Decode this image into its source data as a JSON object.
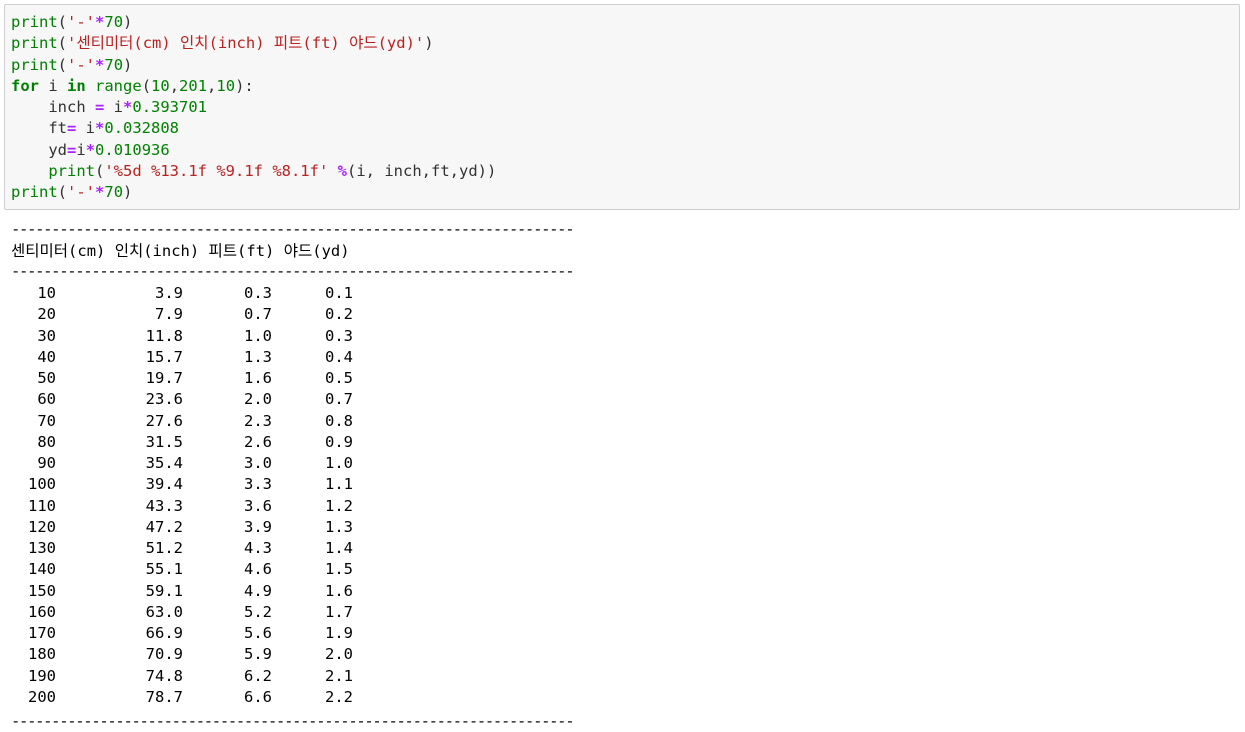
{
  "code": {
    "lines": [
      [
        {
          "t": "print",
          "c": "bi"
        },
        {
          "t": "(",
          "c": "plain"
        },
        {
          "t": "'-'",
          "c": "st"
        },
        {
          "t": "*",
          "c": "op"
        },
        {
          "t": "70",
          "c": "nm"
        },
        {
          "t": ")",
          "c": "plain"
        }
      ],
      [
        {
          "t": "print",
          "c": "bi"
        },
        {
          "t": "(",
          "c": "plain"
        },
        {
          "t": "'센티미터(cm) 인치(inch) 피트(ft) 야드(yd)'",
          "c": "st"
        },
        {
          "t": ")",
          "c": "plain"
        }
      ],
      [
        {
          "t": "print",
          "c": "bi"
        },
        {
          "t": "(",
          "c": "plain"
        },
        {
          "t": "'-'",
          "c": "st"
        },
        {
          "t": "*",
          "c": "op"
        },
        {
          "t": "70",
          "c": "nm"
        },
        {
          "t": ")",
          "c": "plain"
        }
      ],
      [
        {
          "t": "for",
          "c": "kw"
        },
        {
          "t": " i ",
          "c": "plain"
        },
        {
          "t": "in",
          "c": "kw"
        },
        {
          "t": " ",
          "c": "plain"
        },
        {
          "t": "range",
          "c": "bi"
        },
        {
          "t": "(",
          "c": "plain"
        },
        {
          "t": "10",
          "c": "nm"
        },
        {
          "t": ",",
          "c": "plain"
        },
        {
          "t": "201",
          "c": "nm"
        },
        {
          "t": ",",
          "c": "plain"
        },
        {
          "t": "10",
          "c": "nm"
        },
        {
          "t": "):",
          "c": "plain"
        }
      ],
      [
        {
          "t": "    inch ",
          "c": "plain"
        },
        {
          "t": "=",
          "c": "op"
        },
        {
          "t": " i",
          "c": "plain"
        },
        {
          "t": "*",
          "c": "op"
        },
        {
          "t": "0.393701",
          "c": "nm"
        }
      ],
      [
        {
          "t": "    ft",
          "c": "plain"
        },
        {
          "t": "=",
          "c": "op"
        },
        {
          "t": " i",
          "c": "plain"
        },
        {
          "t": "*",
          "c": "op"
        },
        {
          "t": "0.032808",
          "c": "nm"
        }
      ],
      [
        {
          "t": "    yd",
          "c": "plain"
        },
        {
          "t": "=",
          "c": "op"
        },
        {
          "t": "i",
          "c": "plain"
        },
        {
          "t": "*",
          "c": "op"
        },
        {
          "t": "0.010936",
          "c": "nm"
        }
      ],
      [
        {
          "t": "    ",
          "c": "plain"
        },
        {
          "t": "print",
          "c": "bi"
        },
        {
          "t": "(",
          "c": "plain"
        },
        {
          "t": "'%5d %13.1f %9.1f %8.1f'",
          "c": "st"
        },
        {
          "t": " ",
          "c": "plain"
        },
        {
          "t": "%",
          "c": "op"
        },
        {
          "t": "(i, inch,ft,yd))",
          "c": "plain"
        }
      ],
      [
        {
          "t": "print",
          "c": "bi"
        },
        {
          "t": "(",
          "c": "plain"
        },
        {
          "t": "'-'",
          "c": "st"
        },
        {
          "t": "*",
          "c": "op"
        },
        {
          "t": "70",
          "c": "nm"
        },
        {
          "t": ")",
          "c": "plain"
        }
      ]
    ]
  },
  "output": {
    "rule": "----------------------------------------------------------------------",
    "header": "센티미터(cm) 인치(inch) 피트(ft) 야드(yd)",
    "rows": [
      [
        "10",
        "3.9",
        "0.3",
        "0.1"
      ],
      [
        "20",
        "7.9",
        "0.7",
        "0.2"
      ],
      [
        "30",
        "11.8",
        "1.0",
        "0.3"
      ],
      [
        "40",
        "15.7",
        "1.3",
        "0.4"
      ],
      [
        "50",
        "19.7",
        "1.6",
        "0.5"
      ],
      [
        "60",
        "23.6",
        "2.0",
        "0.7"
      ],
      [
        "70",
        "27.6",
        "2.3",
        "0.8"
      ],
      [
        "80",
        "31.5",
        "2.6",
        "0.9"
      ],
      [
        "90",
        "35.4",
        "3.0",
        "1.0"
      ],
      [
        "100",
        "39.4",
        "3.3",
        "1.1"
      ],
      [
        "110",
        "43.3",
        "3.6",
        "1.2"
      ],
      [
        "120",
        "47.2",
        "3.9",
        "1.3"
      ],
      [
        "130",
        "51.2",
        "4.3",
        "1.4"
      ],
      [
        "140",
        "55.1",
        "4.6",
        "1.5"
      ],
      [
        "150",
        "59.1",
        "4.9",
        "1.6"
      ],
      [
        "160",
        "63.0",
        "5.2",
        "1.7"
      ],
      [
        "170",
        "66.9",
        "5.6",
        "1.9"
      ],
      [
        "180",
        "70.9",
        "5.9",
        "2.0"
      ],
      [
        "190",
        "74.8",
        "6.2",
        "2.1"
      ],
      [
        "200",
        "78.7",
        "6.6",
        "2.2"
      ]
    ]
  }
}
